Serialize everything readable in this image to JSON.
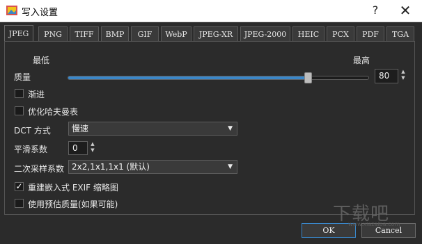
{
  "window": {
    "title": "写入设置",
    "help_glyph": "?",
    "close_glyph": "✕"
  },
  "tabs": [
    {
      "label": "JPEG"
    },
    {
      "label": "PNG"
    },
    {
      "label": "TIFF"
    },
    {
      "label": "BMP"
    },
    {
      "label": "GIF"
    },
    {
      "label": "WebP"
    },
    {
      "label": "JPEG-XR"
    },
    {
      "label": "JPEG-2000"
    },
    {
      "label": "HEIC"
    },
    {
      "label": "PCX"
    },
    {
      "label": "PDF"
    },
    {
      "label": "TGA"
    }
  ],
  "active_tab": "JPEG",
  "quality": {
    "min_label": "最低",
    "max_label": "最高",
    "label": "质量",
    "value": "80",
    "level": 0.8
  },
  "progressive": {
    "label": "渐进",
    "checked": false
  },
  "optimize_huffman": {
    "label": "优化哈夫曼表",
    "checked": false
  },
  "dct": {
    "label": "DCT 方式",
    "value": "慢速"
  },
  "smoothing": {
    "label": "平滑系数",
    "value": "0"
  },
  "subsampling": {
    "label": "二次采样系数",
    "value": "2x2,1x1,1x1 (默认)"
  },
  "rebuild_exif": {
    "label": "重建嵌入式 EXIF 缩略图",
    "checked": true,
    "mark": "✓"
  },
  "estimate_quality": {
    "label": "使用预估质量(如果可能)",
    "checked": false
  },
  "buttons": {
    "ok": "OK",
    "cancel": "Cancel"
  },
  "watermark": {
    "text": "下载吧",
    "sub": "www.xiazaiba.com"
  },
  "colors": {
    "accent": "#3a87c9",
    "background": "#2b2b2b"
  }
}
